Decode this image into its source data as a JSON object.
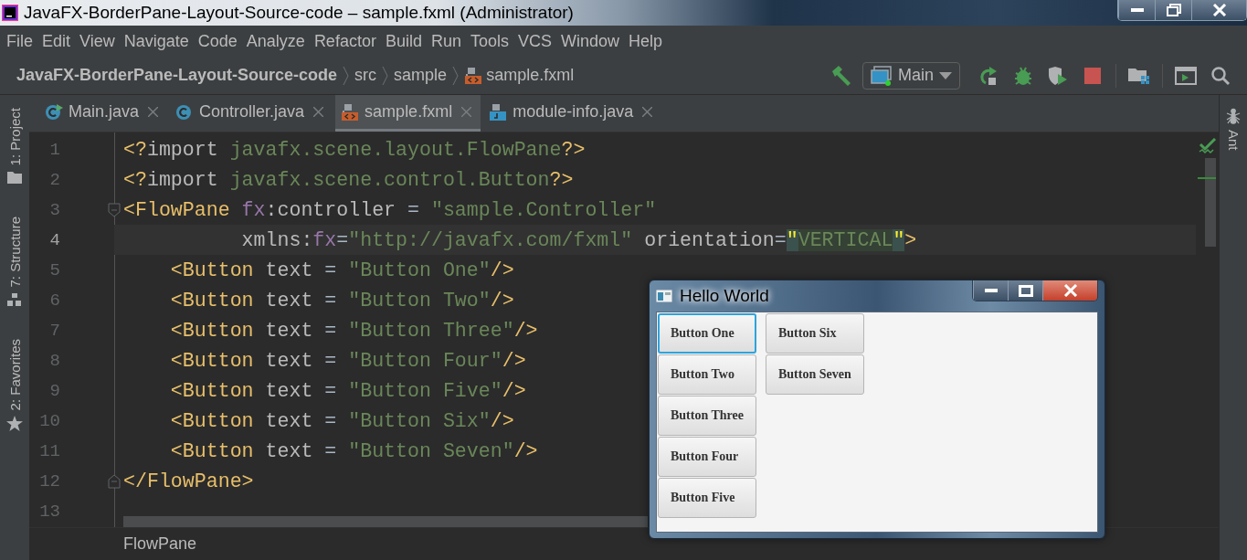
{
  "window": {
    "title": "JavaFX-BorderPane-Layout-Source-code – sample.fxml (Administrator)"
  },
  "menu": [
    {
      "label": "File"
    },
    {
      "label": "Edit"
    },
    {
      "label": "View"
    },
    {
      "label": "Navigate"
    },
    {
      "label": "Code"
    },
    {
      "label": "Analyze"
    },
    {
      "label": "Refactor"
    },
    {
      "label": "Build"
    },
    {
      "label": "Run"
    },
    {
      "label": "Tools"
    },
    {
      "label": "VCS"
    },
    {
      "label": "Window"
    },
    {
      "label": "Help"
    }
  ],
  "navigation": {
    "breadcrumbs": [
      {
        "label": "JavaFX-BorderPane-Layout-Source-code",
        "kind": "project"
      },
      {
        "label": "src",
        "kind": "folder"
      },
      {
        "label": "sample",
        "kind": "folder"
      },
      {
        "label": "sample.fxml",
        "kind": "fxml"
      }
    ],
    "run_configuration": "Main"
  },
  "tool_windows": {
    "left": [
      {
        "label": "1: Project",
        "kind": "folder"
      },
      {
        "label": "7: Structure",
        "kind": "structure"
      },
      {
        "label": "2: Favorites",
        "kind": "star"
      }
    ],
    "right": [
      {
        "label": "Ant",
        "kind": "ant"
      }
    ]
  },
  "tabs": [
    {
      "label": "Main.java",
      "kind": "class-run",
      "selected": false
    },
    {
      "label": "Controller.java",
      "kind": "class",
      "selected": false
    },
    {
      "label": "sample.fxml",
      "kind": "fxml",
      "selected": true
    },
    {
      "label": "module-info.java",
      "kind": "module",
      "selected": false
    }
  ],
  "editor": {
    "lines": [
      {
        "number": "1",
        "current": false,
        "fold": false,
        "tokens": [
          {
            "kind": "tag",
            "text": "<?"
          },
          {
            "kind": "attr",
            "text": "import "
          },
          {
            "kind": "str",
            "text": "javafx.scene.layout.FlowPane"
          },
          {
            "kind": "tag",
            "text": "?>"
          }
        ]
      },
      {
        "number": "2",
        "current": false,
        "fold": false,
        "tokens": [
          {
            "kind": "tag",
            "text": "<?"
          },
          {
            "kind": "attr",
            "text": "import "
          },
          {
            "kind": "str",
            "text": "javafx.scene.control.Button"
          },
          {
            "kind": "tag",
            "text": "?>"
          }
        ]
      },
      {
        "number": "3",
        "current": false,
        "fold": true,
        "tokens": [
          {
            "kind": "tag",
            "text": "<FlowPane "
          },
          {
            "kind": "ns",
            "text": "fx"
          },
          {
            "kind": "attr",
            "text": ":controller"
          },
          {
            "kind": "punct",
            "text": " = "
          },
          {
            "kind": "str",
            "text": "\"sample.Controller\""
          }
        ]
      },
      {
        "number": "4",
        "current": true,
        "fold": false,
        "tokens": [
          {
            "kind": "attr",
            "text": "          xmlns:"
          },
          {
            "kind": "ns",
            "text": "fx"
          },
          {
            "kind": "punct",
            "text": "="
          },
          {
            "kind": "str",
            "text": "\"http://javafx.com/fxml\""
          },
          {
            "kind": "attr",
            "text": " orientation"
          },
          {
            "kind": "punct",
            "text": "="
          },
          {
            "kind": "quote-match",
            "text": "\""
          },
          {
            "kind": "str-selected",
            "text": "VERTICAL"
          },
          {
            "kind": "quote-match",
            "text": "\""
          },
          {
            "kind": "tag",
            "text": ">"
          }
        ]
      },
      {
        "number": "5",
        "current": false,
        "fold": false,
        "tokens": [
          {
            "kind": "tag",
            "text": "    <Button"
          },
          {
            "kind": "attr",
            "text": " text"
          },
          {
            "kind": "punct",
            "text": " = "
          },
          {
            "kind": "str",
            "text": "\"Button One\""
          },
          {
            "kind": "tag",
            "text": "/>"
          }
        ]
      },
      {
        "number": "6",
        "current": false,
        "fold": false,
        "tokens": [
          {
            "kind": "tag",
            "text": "    <Button"
          },
          {
            "kind": "attr",
            "text": " text"
          },
          {
            "kind": "punct",
            "text": " = "
          },
          {
            "kind": "str",
            "text": "\"Button Two\""
          },
          {
            "kind": "tag",
            "text": "/>"
          }
        ]
      },
      {
        "number": "7",
        "current": false,
        "fold": false,
        "tokens": [
          {
            "kind": "tag",
            "text": "    <Button"
          },
          {
            "kind": "attr",
            "text": " text"
          },
          {
            "kind": "punct",
            "text": " = "
          },
          {
            "kind": "str",
            "text": "\"Button Three\""
          },
          {
            "kind": "tag",
            "text": "/>"
          }
        ]
      },
      {
        "number": "8",
        "current": false,
        "fold": false,
        "tokens": [
          {
            "kind": "tag",
            "text": "    <Button"
          },
          {
            "kind": "attr",
            "text": " text"
          },
          {
            "kind": "punct",
            "text": " = "
          },
          {
            "kind": "str",
            "text": "\"Button Four\""
          },
          {
            "kind": "tag",
            "text": "/>"
          }
        ]
      },
      {
        "number": "9",
        "current": false,
        "fold": false,
        "tokens": [
          {
            "kind": "tag",
            "text": "    <Button"
          },
          {
            "kind": "attr",
            "text": " text"
          },
          {
            "kind": "punct",
            "text": " = "
          },
          {
            "kind": "str",
            "text": "\"Button Five\""
          },
          {
            "kind": "tag",
            "text": "/>"
          }
        ]
      },
      {
        "number": "10",
        "current": false,
        "fold": false,
        "tokens": [
          {
            "kind": "tag",
            "text": "    <Button"
          },
          {
            "kind": "attr",
            "text": " text"
          },
          {
            "kind": "punct",
            "text": " = "
          },
          {
            "kind": "str",
            "text": "\"Button Six\""
          },
          {
            "kind": "tag",
            "text": "/>"
          }
        ]
      },
      {
        "number": "11",
        "current": false,
        "fold": false,
        "tokens": [
          {
            "kind": "tag",
            "text": "    <Button"
          },
          {
            "kind": "attr",
            "text": " text"
          },
          {
            "kind": "punct",
            "text": " = "
          },
          {
            "kind": "str",
            "text": "\"Button Seven\""
          },
          {
            "kind": "tag",
            "text": "/>"
          }
        ]
      },
      {
        "number": "12",
        "current": false,
        "fold": true,
        "tokens": [
          {
            "kind": "tag",
            "text": "</FlowPane>"
          }
        ]
      },
      {
        "number": "13",
        "current": false,
        "fold": false
      }
    ]
  },
  "footer_breadcrumb": "FlowPane",
  "app_window": {
    "title": "Hello World",
    "buttons": [
      {
        "label": "Button One",
        "focused": true
      },
      {
        "label": "Button Two",
        "focused": false
      },
      {
        "label": "Button Three",
        "focused": false
      },
      {
        "label": "Button Four",
        "focused": false
      },
      {
        "label": "Button Five",
        "focused": false
      },
      {
        "label": "Button Six",
        "focused": false
      },
      {
        "label": "Button Seven",
        "focused": false
      }
    ]
  }
}
